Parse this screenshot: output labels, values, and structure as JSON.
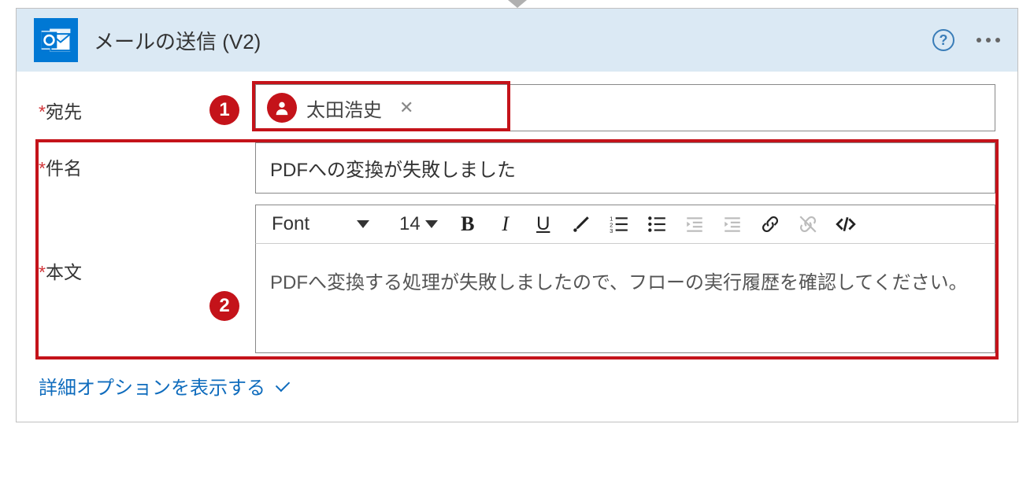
{
  "header": {
    "title": "メールの送信 (V2)"
  },
  "callouts": {
    "one": "1",
    "two": "2"
  },
  "fields": {
    "to": {
      "label": "宛先",
      "recipient_name": "太田浩史"
    },
    "subject": {
      "label": "件名",
      "value": "PDFへの変換が失敗しました"
    },
    "body": {
      "label": "本文",
      "font_label": "Font",
      "font_size": "14",
      "content": "PDFへ変換する処理が失敗しましたので、フローの実行履歴を確認してください。"
    }
  },
  "advanced_link": "詳細オプションを表示する"
}
